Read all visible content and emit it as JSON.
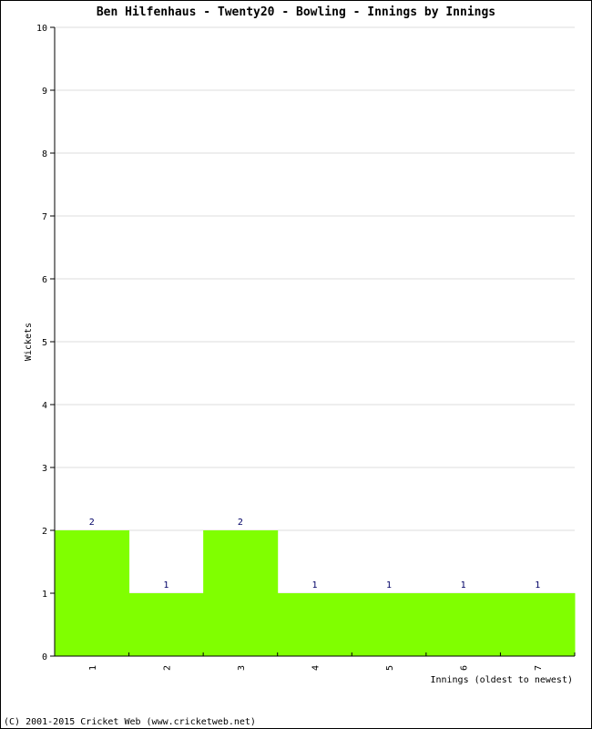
{
  "chart_data": {
    "type": "bar",
    "title": "Ben Hilfenhaus - Twenty20 - Bowling - Innings by Innings",
    "xlabel": "Innings (oldest to newest)",
    "ylabel": "Wickets",
    "categories": [
      "1",
      "2",
      "3",
      "4",
      "5",
      "6",
      "7"
    ],
    "values": [
      2,
      1,
      2,
      1,
      1,
      1,
      1
    ],
    "data_labels": [
      "2",
      "1",
      "2",
      "1",
      "1",
      "1",
      "1"
    ],
    "ylim": [
      0,
      10
    ],
    "yticks": [
      "0",
      "1",
      "2",
      "3",
      "4",
      "5",
      "6",
      "7",
      "8",
      "9",
      "10"
    ],
    "grid": true,
    "bar_color": "#80ff00",
    "label_color": "#000066",
    "grid_color": "#dddddd"
  },
  "footer": "(C) 2001-2015 Cricket Web (www.cricketweb.net)"
}
